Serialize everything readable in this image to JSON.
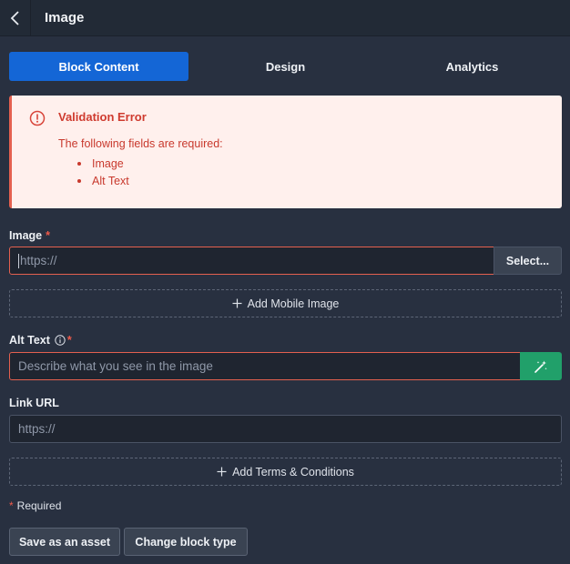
{
  "header": {
    "title": "Image"
  },
  "tabs": [
    {
      "label": "Block Content",
      "active": true
    },
    {
      "label": "Design",
      "active": false
    },
    {
      "label": "Analytics",
      "active": false
    }
  ],
  "alert": {
    "title": "Validation Error",
    "message": "The following fields are required:",
    "items": [
      "Image",
      "Alt Text"
    ]
  },
  "image_field": {
    "label": "Image",
    "required_mark": "*",
    "placeholder": "https://",
    "select_label": "Select..."
  },
  "add_mobile_image": {
    "label": "Add Mobile Image"
  },
  "alt_text_field": {
    "label": "Alt Text",
    "required_mark": "*",
    "placeholder": "Describe what you see in the image"
  },
  "link_url_field": {
    "label": "Link URL",
    "placeholder": "https://"
  },
  "add_terms": {
    "label": "Add Terms & Conditions"
  },
  "required_note": {
    "star": "*",
    "text": "Required"
  },
  "actions": {
    "save_asset": "Save as an asset",
    "change_block_type": "Change block type"
  },
  "colors": {
    "background": "#283040",
    "header": "#222a36",
    "accent": "#1466d6",
    "error": "#e4604f",
    "success": "#21a06a"
  }
}
